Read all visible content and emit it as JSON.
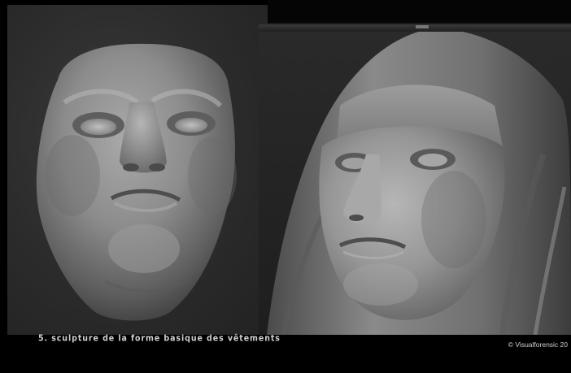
{
  "image": {
    "left_panel": {
      "subject": "sculpted face mask (front-up view)"
    },
    "right_panel": {
      "subject": "sculpted nun head with veil (three-quarter view)"
    }
  },
  "caption": {
    "text": "5. sculpture de la forme basique des vêtements"
  },
  "credit": {
    "text": "© Visualforensic 20"
  },
  "colors": {
    "background": "#000000",
    "panel": "#2b2b2b",
    "clay": "#8e8e8e",
    "caption": "#cfcfcf"
  }
}
